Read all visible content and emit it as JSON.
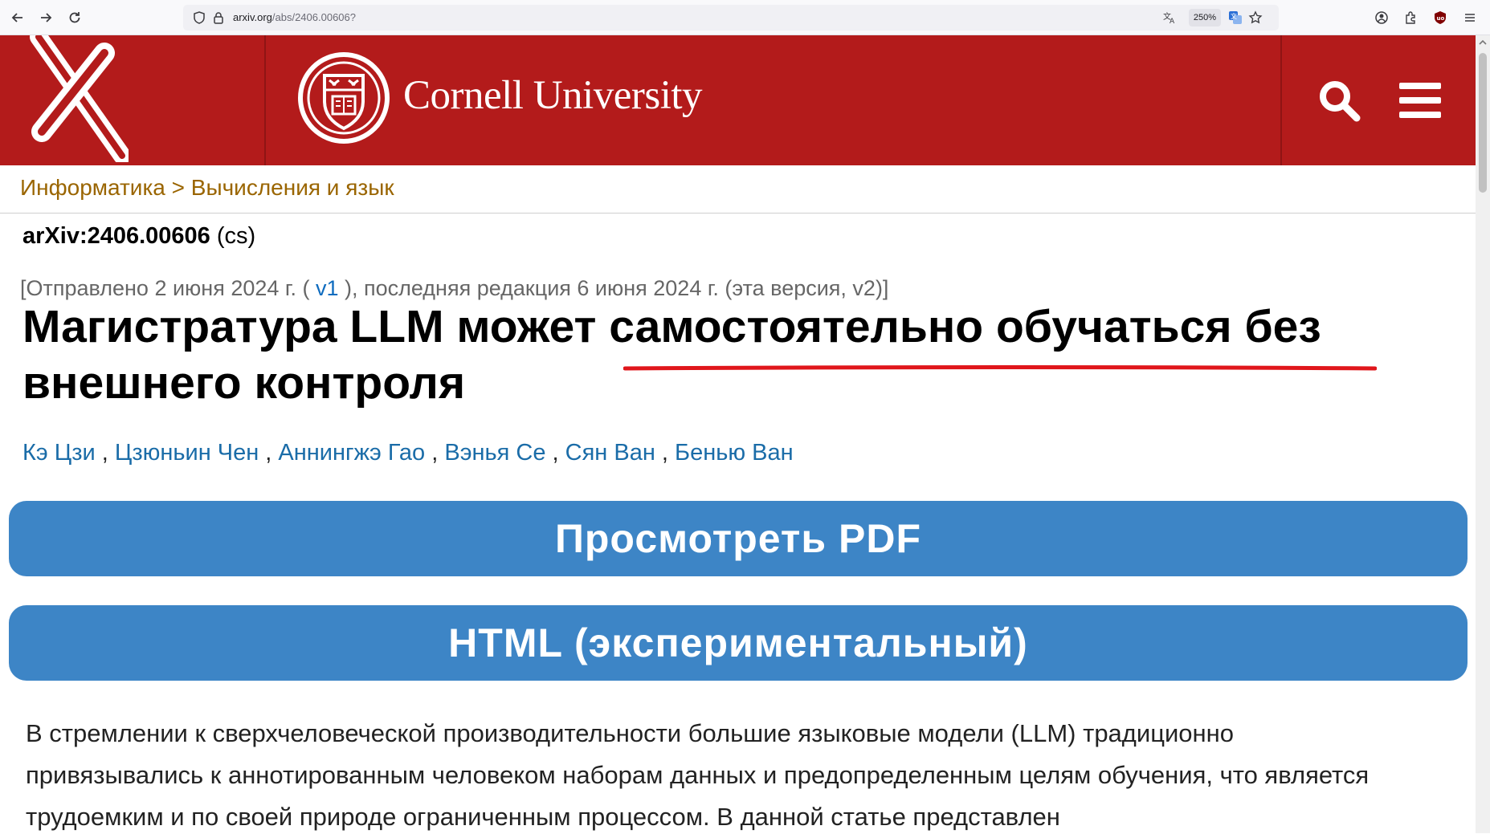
{
  "browser": {
    "url_host": "arxiv.org",
    "url_path": "/abs/2406.00606?",
    "zoom": "250%",
    "icons": [
      "back-icon",
      "forward-icon",
      "reload-icon",
      "shield-icon",
      "lock-icon",
      "translate-icon",
      "translate-active-icon",
      "bookmark-star-icon",
      "account-icon",
      "extensions-icon",
      "ublock-icon",
      "menu-icon"
    ]
  },
  "header": {
    "university": "Cornell University",
    "brand_color": "#b31b1b",
    "icons": [
      "arxiv-logo",
      "cornell-seal",
      "search-icon",
      "hamburger-menu-icon"
    ]
  },
  "breadcrumb": "Информатика > Вычисления и язык",
  "paper": {
    "id": "arXiv:2406.00606",
    "category": "(cs)",
    "submission_pre": "[Отправлено 2 июня 2024 г. ( ",
    "submission_v1": "v1",
    "submission_post": " ), последняя редакция 6 июня 2024 г. (эта версия, v2)]",
    "title": "Магистратура LLM может самостоятельно обучаться без внешнего контроля",
    "authors": [
      "Кэ Цзи",
      "Цзюньин Чен",
      "Аннингжэ Гао",
      "Вэнья Се",
      "Сян Ван",
      "Бенью Ван"
    ],
    "author_separator": " , ",
    "buttons": {
      "pdf": "Просмотреть PDF",
      "html": "HTML (экспериментальный)"
    },
    "abstract": "В стремлении к сверхчеловеческой производительности большие языковые модели (LLM) традиционно привязывались к аннотированным человеком наборам данных и предопределенным целям обучения, что является трудоемким и по своей природе ограниченным процессом. В данной статье представлен"
  },
  "colors": {
    "link": "#1a6ca8",
    "breadcrumb": "#9a6500",
    "button": "#3d85c6",
    "underline": "#e0161b"
  }
}
